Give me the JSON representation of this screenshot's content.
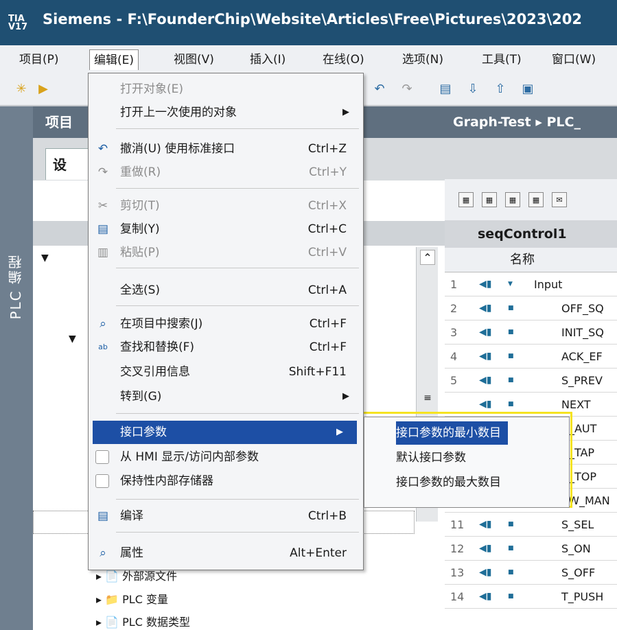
{
  "title_bar": {
    "logo": "TIA V17",
    "title": "Siemens  -  F:\\FounderChip\\Website\\Articles\\Free\\Pictures\\2023\\202"
  },
  "menubar": [
    "项目(P)",
    "编辑(E)",
    "视图(V)",
    "插入(I)",
    "在线(O)",
    "选项(N)",
    "工具(T)",
    "窗口(W)"
  ],
  "left_panel": {
    "vertical_label": "PLC 编程",
    "header": "项目",
    "design_tab": "设",
    "tree": [
      "外部源文件",
      "PLC 变量",
      "PLC 数据类型"
    ]
  },
  "right_panel": {
    "breadcrumb": "Graph-Test ▸ PLC_",
    "block_title": "seqControl1",
    "column_header": "名称",
    "rows": [
      {
        "num": "1",
        "name": "Input"
      },
      {
        "num": "2",
        "name": "OFF_SQ"
      },
      {
        "num": "3",
        "name": "INIT_SQ"
      },
      {
        "num": "4",
        "name": "ACK_EF"
      },
      {
        "num": "5",
        "name": "S_PREV"
      },
      {
        "num": "",
        "name": "NEXT"
      },
      {
        "num": "",
        "name": "V_AUT"
      },
      {
        "num": "",
        "name": "V_TAP"
      },
      {
        "num": "",
        "name": "V_TOP"
      },
      {
        "num": "10",
        "name": "SW_MAN"
      },
      {
        "num": "11",
        "name": "S_SEL"
      },
      {
        "num": "12",
        "name": "S_ON"
      },
      {
        "num": "13",
        "name": "S_OFF"
      },
      {
        "num": "14",
        "name": "T_PUSH"
      }
    ]
  },
  "edit_menu": {
    "open_object": "打开对象(E)",
    "open_last": "打开上一次使用的对象",
    "undo": "撤消(U) 使用标准接口",
    "undo_sc": "Ctrl+Z",
    "redo": "重做(R)",
    "redo_sc": "Ctrl+Y",
    "cut": "剪切(T)",
    "cut_sc": "Ctrl+X",
    "copy": "复制(Y)",
    "copy_sc": "Ctrl+C",
    "paste": "粘贴(P)",
    "paste_sc": "Ctrl+V",
    "select_all": "全选(S)",
    "select_all_sc": "Ctrl+A",
    "search_project": "在项目中搜索(J)",
    "search_project_sc": "Ctrl+F",
    "find_replace": "查找和替换(F)",
    "find_replace_sc": "Ctrl+F",
    "cross_ref": "交叉引用信息",
    "cross_ref_sc": "Shift+F11",
    "goto": "转到(G)",
    "interface_params": "接口参数",
    "hmi_access": "从 HMI 显示/访问内部参数",
    "retentive": "保持性内部存储器",
    "compile": "编译",
    "compile_sc": "Ctrl+B",
    "properties": "属性",
    "properties_sc": "Alt+Enter"
  },
  "submenu": {
    "min": "接口参数的最小数目",
    "default": "默认接口参数",
    "max": "接口参数的最大数目"
  },
  "highlight_color": "#f5e321",
  "selection_color": "#1d4fa5"
}
